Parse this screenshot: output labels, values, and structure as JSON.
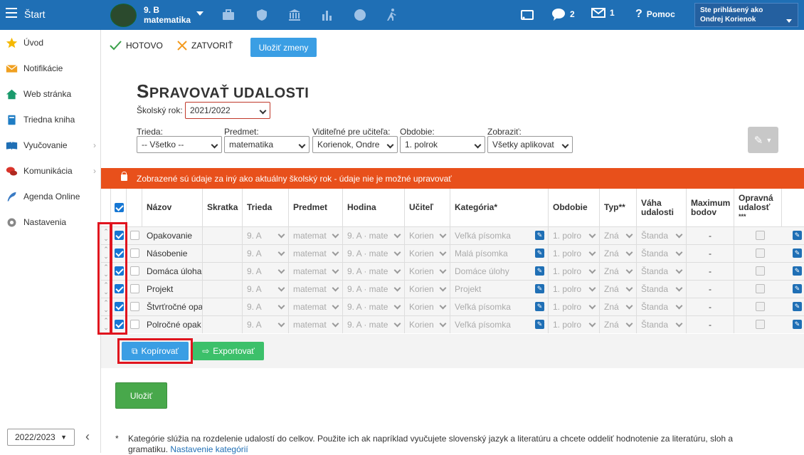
{
  "topbar": {
    "start_label": "Štart",
    "class_name": "9. B",
    "subject_name": "matematika",
    "messages_count": "2",
    "mail_count": "1",
    "help_label": "Pomoc",
    "logged_label": "Ste prihlásený ako",
    "user_name": "Ondrej Korienok",
    "bg_color": "#1f6fb5"
  },
  "sidebar": {
    "items": [
      {
        "label": "Úvod",
        "icon": "star-icon"
      },
      {
        "label": "Notifikácie",
        "icon": "envelope-icon"
      },
      {
        "label": "Web stránka",
        "icon": "house-icon"
      },
      {
        "label": "Triedna kniha",
        "icon": "book-icon"
      },
      {
        "label": "Vyučovanie",
        "icon": "open-book-icon"
      },
      {
        "label": "Komunikácia",
        "icon": "chat-icon"
      },
      {
        "label": "Agenda Online",
        "icon": "feather-icon"
      },
      {
        "label": "Nastavenia",
        "icon": "gear-icon"
      }
    ],
    "school_year": "2022/2023"
  },
  "actions": {
    "done": "HOTOVO",
    "close": "ZATVORIŤ",
    "save_changes": "Uložiť zmeny"
  },
  "page": {
    "title_first": "S",
    "title_rest": "PRAVOVAŤ UDALOSTI",
    "school_year_label": "Školský rok:",
    "school_year_value": "2021/2022"
  },
  "filters": {
    "class_label": "Trieda:",
    "class_value": "-- Všetko --",
    "subject_label": "Predmet:",
    "subject_value": "matematika",
    "teacher_label": "Viditeľné pre učiteľa:",
    "teacher_value": "Korienok, Ondre",
    "period_label": "Obdobie:",
    "period_value": "1. polrok",
    "show_label": "Zobraziť:",
    "show_value": "Všetky aplikovat"
  },
  "alert": {
    "text": "Zobrazené sú údaje za iný ako aktuálny školský rok - údaje nie je možné upravovať",
    "color": "#e8501b"
  },
  "table": {
    "headers": {
      "name": "Názov",
      "short": "Skratka",
      "class": "Trieda",
      "subject": "Predmet",
      "hour": "Hodina",
      "teacher": "Učiteľ",
      "category": "Kategória*",
      "period": "Obdobie",
      "type": "Typ**",
      "weight": "Váha udalosti",
      "max": "Maximum bodov",
      "retake": "Opravná udalosť",
      "retake_note": "***"
    },
    "rows": [
      {
        "name": "Opakovanie",
        "class": "9. A",
        "subject": "matemat",
        "hour": "9. A · mate",
        "teacher": "Korien",
        "category": "Veľká písomka",
        "period": "1. polro",
        "type": "Zná",
        "weight": "Štanda",
        "max": "-"
      },
      {
        "name": "Násobenie",
        "class": "9. A",
        "subject": "matemat",
        "hour": "9. A · mate",
        "teacher": "Korien",
        "category": "Malá písomka",
        "period": "1. polro",
        "type": "Zná",
        "weight": "Štanda",
        "max": "-"
      },
      {
        "name": "Domáca úloha",
        "class": "9. A",
        "subject": "matemat",
        "hour": "9. A · mate",
        "teacher": "Korien",
        "category": "Domáce úlohy",
        "period": "1. polro",
        "type": "Zná",
        "weight": "Štanda",
        "max": "-"
      },
      {
        "name": "Projekt",
        "class": "9. A",
        "subject": "matemat",
        "hour": "9. A · mate",
        "teacher": "Korien",
        "category": "Projekt",
        "period": "1. polro",
        "type": "Zná",
        "weight": "Štanda",
        "max": "-"
      },
      {
        "name": "Štvrťročné opa",
        "class": "9. A",
        "subject": "matemat",
        "hour": "9. A · mate",
        "teacher": "Korien",
        "category": "Veľká písomka",
        "period": "1. polro",
        "type": "Zná",
        "weight": "Štanda",
        "max": "-"
      },
      {
        "name": "Polročné opak",
        "class": "9. A",
        "subject": "matemat",
        "hour": "9. A · mate",
        "teacher": "Korien",
        "category": "Veľká písomka",
        "period": "1. polro",
        "type": "Zná",
        "weight": "Štanda",
        "max": "-"
      }
    ]
  },
  "buttons": {
    "copy": "Kopírovať",
    "export": "Exportovať",
    "save": "Uložiť"
  },
  "footnote": {
    "star": "*",
    "text": "Kategórie slúžia na rozdelenie udalostí do celkov. Použite ich ak napríklad vyučujete slovenský jazyk a literatúru a chcete oddeliť hodnotenie za literatúru, sloh a gramatiku.",
    "link": "Nastavenie kategórií"
  }
}
